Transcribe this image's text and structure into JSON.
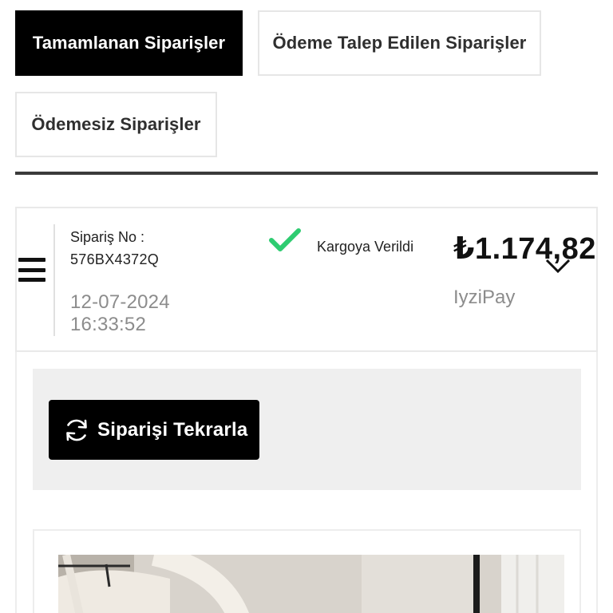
{
  "tabs": [
    {
      "label": "Tamamlanan Siparişler",
      "active": true
    },
    {
      "label": "Ödeme Talep Edilen Siparişler",
      "active": false
    },
    {
      "label": "Ödemesiz Siparişler",
      "active": false
    }
  ],
  "order": {
    "order_no_label": "Sipariş No :",
    "order_no": "576BX4372Q",
    "date": "12-07-2024",
    "time": "16:33:52",
    "status": "Kargoya Verildi",
    "total": "₺1.174,82",
    "payment_method": "IyziPay"
  },
  "actions": {
    "reorder_label": "Siparişi Tekrarla"
  },
  "icons": {
    "menu": "menu-icon",
    "status": "check-icon",
    "expand": "chevron-down-icon",
    "reorder": "refresh-icon"
  },
  "colors": {
    "accent": "#000000",
    "status_check": "#2ecc71",
    "muted_text": "#8c8c8c",
    "panel_bg": "#efefef"
  }
}
